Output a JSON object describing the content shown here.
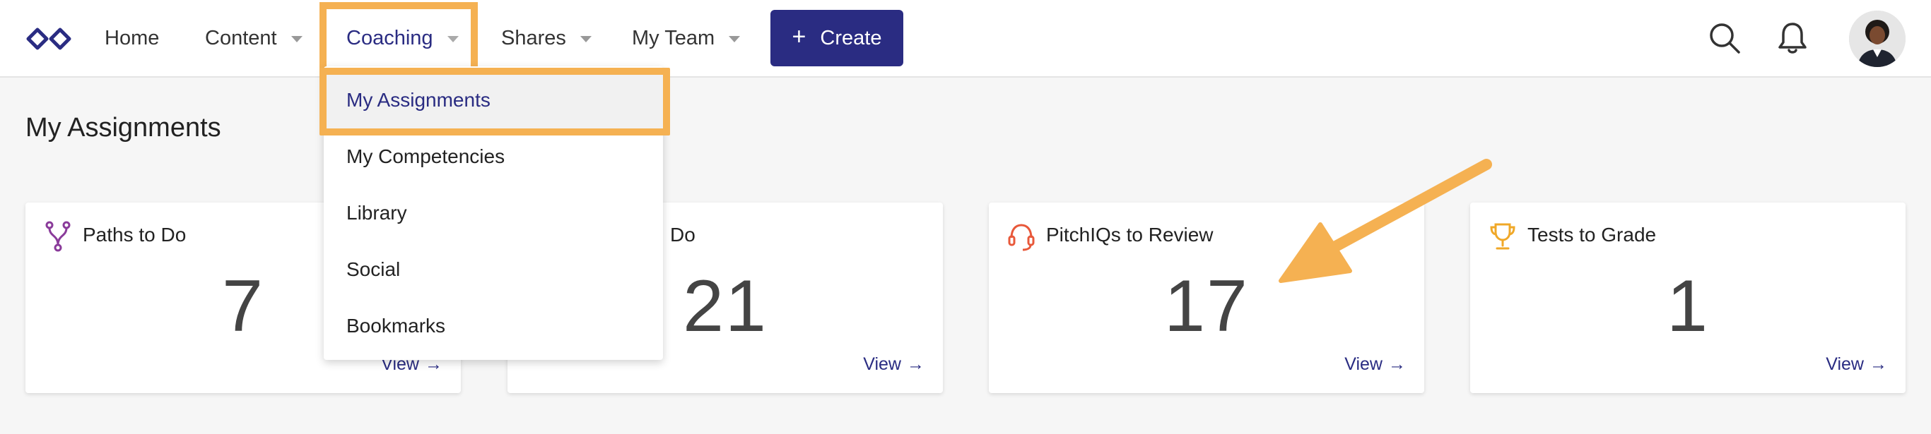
{
  "nav": {
    "items": [
      {
        "label": "Home"
      },
      {
        "label": "Content"
      },
      {
        "label": "Coaching"
      },
      {
        "label": "Shares"
      },
      {
        "label": "My Team"
      }
    ],
    "create_label": "Create"
  },
  "dropdown": {
    "items": [
      {
        "label": "My Assignments"
      },
      {
        "label": "My Competencies"
      },
      {
        "label": "Library"
      },
      {
        "label": "Social"
      },
      {
        "label": "Bookmarks"
      }
    ]
  },
  "page": {
    "title": "My Assignments"
  },
  "cards": [
    {
      "title": "Paths to Do",
      "value": "7",
      "link": "View"
    },
    {
      "title": "Do",
      "value": "21",
      "link": "View"
    },
    {
      "title": "PitchIQs to Review",
      "value": "17",
      "link": "View"
    },
    {
      "title": "Tests to Grade",
      "value": "1",
      "link": "View"
    }
  ],
  "colors": {
    "brand": "#2a2c82",
    "highlight": "#f5b152",
    "paths_icon": "#8a3b9a",
    "pitchiq_icon": "#e8583a",
    "tests_icon": "#f0a828"
  },
  "icons": {
    "logo": "infinity-logo-icon",
    "search": "search-icon",
    "bell": "bell-icon",
    "paths": "fork-path-icon",
    "pitchiq": "headset-icon",
    "tests": "trophy-icon"
  }
}
